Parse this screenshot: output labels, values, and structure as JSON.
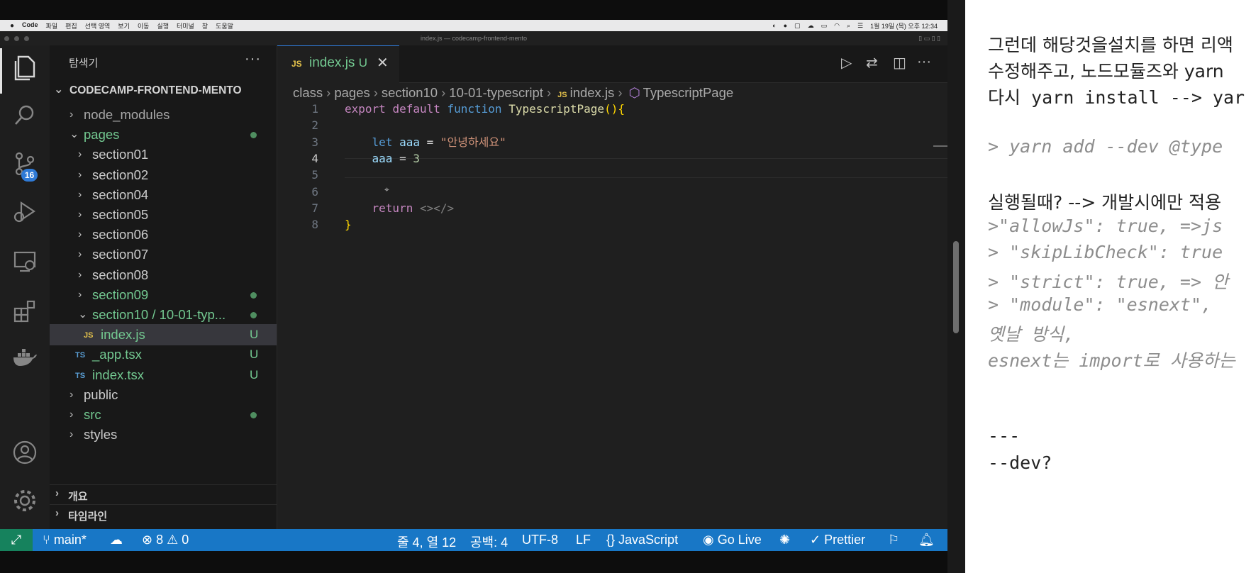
{
  "menubar": {
    "apple": "",
    "items": [
      "Code",
      "파일",
      "편집",
      "선택 영역",
      "보기",
      "이동",
      "실행",
      "터미널",
      "창",
      "도움말"
    ],
    "datetime": "1월 19일 (목) 오후 12:34"
  },
  "window": {
    "title": "index.js — codecamp-frontend-mento"
  },
  "activity": {
    "scm_badge": "16"
  },
  "sidebar": {
    "title": "탐색기",
    "more": "···",
    "root": "CODECAMP-FRONTEND-MENTO",
    "tree": [
      {
        "label": "node_modules",
        "indent": 1,
        "chev": "›",
        "style": "dim"
      },
      {
        "label": "pages",
        "indent": 1,
        "chev": "⌄",
        "style": "green",
        "dot": true
      },
      {
        "label": "section01",
        "indent": 2,
        "chev": "›"
      },
      {
        "label": "section02",
        "indent": 2,
        "chev": "›"
      },
      {
        "label": "section04",
        "indent": 2,
        "chev": "›"
      },
      {
        "label": "section05",
        "indent": 2,
        "chev": "›"
      },
      {
        "label": "section06",
        "indent": 2,
        "chev": "›"
      },
      {
        "label": "section07",
        "indent": 2,
        "chev": "›"
      },
      {
        "label": "section08",
        "indent": 2,
        "chev": "›"
      },
      {
        "label": "section09",
        "indent": 2,
        "chev": "›",
        "style": "green",
        "dot": true
      },
      {
        "label": "section10 / 10-01-typ...",
        "indent": 2,
        "chev": "⌄",
        "style": "green",
        "dot": true
      },
      {
        "label": "index.js",
        "indent": 3,
        "type": "JS",
        "style": "green",
        "u": "U",
        "selected": true
      },
      {
        "label": "_app.tsx",
        "indent": 2,
        "type": "TS",
        "style": "green",
        "u": "U"
      },
      {
        "label": "index.tsx",
        "indent": 2,
        "type": "TS",
        "style": "green",
        "u": "U"
      },
      {
        "label": "public",
        "indent": 1,
        "chev": "›"
      },
      {
        "label": "src",
        "indent": 1,
        "chev": "›",
        "style": "green",
        "dot": true
      },
      {
        "label": "styles",
        "indent": 1,
        "chev": "›"
      }
    ],
    "panel_outline": "개요",
    "panel_timeline": "타임라인"
  },
  "editor": {
    "tab": {
      "icon": "JS",
      "name": "index.js",
      "status": "U"
    },
    "breadcrumbs": [
      "class",
      "pages",
      "section10",
      "10-01-typescript",
      "index.js",
      "TypescriptPage"
    ],
    "breadcrumb_js": "JS",
    "lines": [
      {
        "num": "1",
        "parts": [
          [
            "kw",
            "export "
          ],
          [
            "kw",
            "default "
          ],
          [
            "kb",
            "function "
          ],
          [
            "fn",
            "TypescriptPage"
          ],
          [
            "br",
            "(){"
          ]
        ]
      },
      {
        "num": "2",
        "parts": []
      },
      {
        "num": "3",
        "parts": [
          [
            "pl",
            "    "
          ],
          [
            "kb",
            "let "
          ],
          [
            "vr",
            "aaa"
          ],
          [
            "pl",
            " = "
          ],
          [
            "st",
            "\"안녕하세요\""
          ]
        ]
      },
      {
        "num": "4",
        "parts": [
          [
            "pl",
            "    "
          ],
          [
            "vr",
            "aaa"
          ],
          [
            "pl",
            " = "
          ],
          [
            "nm",
            "3"
          ]
        ]
      },
      {
        "num": "5",
        "parts": []
      },
      {
        "num": "6",
        "parts": []
      },
      {
        "num": "7",
        "parts": [
          [
            "pl",
            "    "
          ],
          [
            "kw",
            "return "
          ],
          [
            "tg",
            "<></>"
          ]
        ]
      },
      {
        "num": "8",
        "parts": [
          [
            "br",
            "}"
          ]
        ]
      }
    ]
  },
  "statusbar": {
    "branch": "main*",
    "errors": "8",
    "warnings": "0",
    "position": "줄 4, 열 12",
    "spaces": "공백: 4",
    "encoding": "UTF-8",
    "eol": "LF",
    "language": "JavaScript",
    "golive": "Go Live",
    "prettier": "Prettier"
  },
  "notes": {
    "lines": [
      {
        "text": "그런데 해당것을설치를 하면 리액",
        "style": "sans"
      },
      {
        "text": "수정해주고, 노드모듈즈와 yarn",
        "style": "sans"
      },
      {
        "text": "다시 yarn install --> yar",
        "style": "mono"
      },
      {
        "text": "> yarn add --dev @type",
        "style": "it"
      },
      {
        "text": "실행될때? --> 개발시에만 적용",
        "style": "sans"
      },
      {
        "text": ">\"allowJs\": true, =>js",
        "style": "it"
      },
      {
        "text": "> \"skipLibCheck\": true",
        "style": "it"
      },
      {
        "text": "> \"strict\": true, => 안",
        "style": "it"
      },
      {
        "text": ">  \"module\": \"esnext\", ",
        "style": "it"
      },
      {
        "text": "옛날 방식,",
        "style": "it"
      },
      {
        "text": "esnext는 import로 사용하는",
        "style": "it"
      },
      {
        "text": "---",
        "style": "mono"
      },
      {
        "text": "--dev?",
        "style": "mono"
      }
    ]
  }
}
